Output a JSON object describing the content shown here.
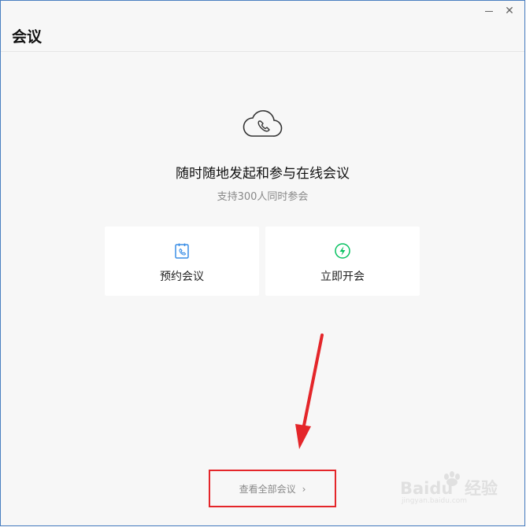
{
  "window": {
    "title": "会议"
  },
  "hero": {
    "icon": "cloud-phone-icon",
    "headline": "随时随地发起和参与在线会议",
    "subline": "支持300人同时参会"
  },
  "actions": [
    {
      "label": "预约会议",
      "icon": "calendar-phone-icon",
      "color": "#3a8ee6"
    },
    {
      "label": "立即开会",
      "icon": "lightning-icon",
      "color": "#07c160"
    }
  ],
  "footer": {
    "view_all_label": "查看全部会议",
    "chevron": "›"
  },
  "annotation": {
    "arrow_color": "#e4262a",
    "box_color": "#e4262a"
  },
  "watermark": {
    "brand": "Baidu",
    "label": "经验",
    "url": "jingyan.baidu.com"
  }
}
